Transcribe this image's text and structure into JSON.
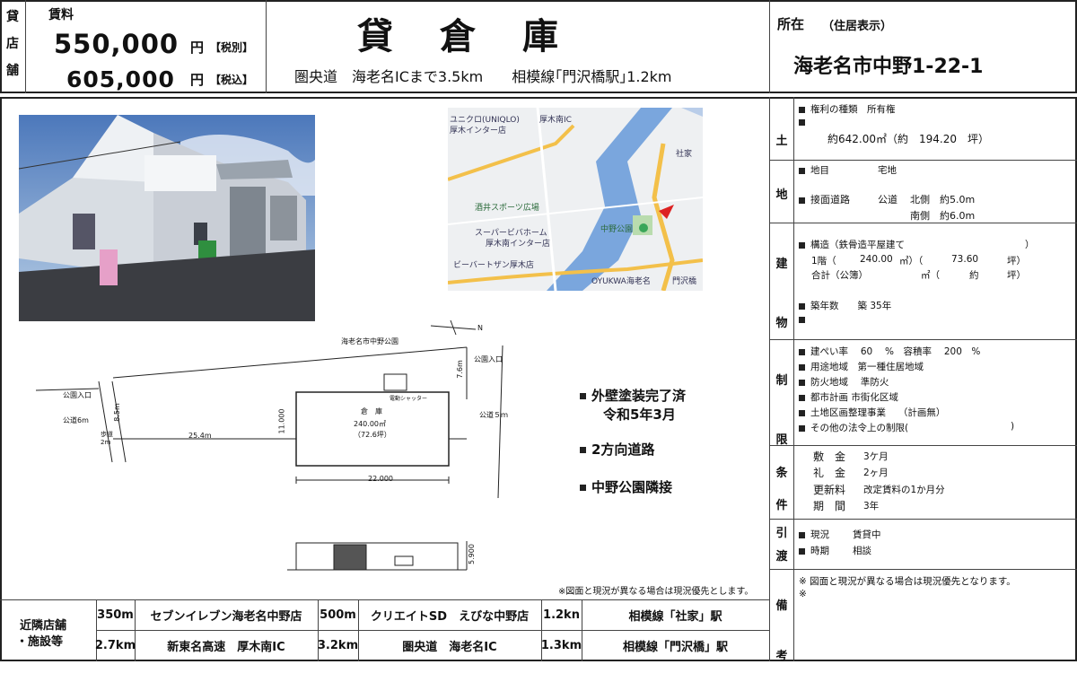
{
  "header": {
    "side_label": [
      "貸",
      "店",
      "舗"
    ],
    "rent_label": "賃料",
    "rent_ex_tax": "550,000",
    "rent_in_tax": "605,000",
    "yen": "円",
    "ex_tax_tag": "【税別】",
    "in_tax_tag": "【税込】",
    "title": "貸　倉　庫",
    "access": "圏央道　海老名ICまで3.5km　　相模線｢門沢橋駅｣1.2km",
    "location_label": "所在",
    "location_note": "（住居表示）",
    "address": "海老名市中野1-22-1"
  },
  "map": {
    "labels": [
      "ユニクロ(UNIQLO)",
      "厚木インター店",
      "酒井スポーツ広場",
      "スーパービバホーム",
      "厚木南インター店",
      "ビーバートザン厚木店",
      "中野公園",
      "社家",
      "厚木南IC",
      "OYUKWA海老名",
      "門沢橋"
    ]
  },
  "site_plan": {
    "park_label": "海老名市中野公園",
    "park_entrance_left": "公園入口",
    "park_entrance_right": "公園入口",
    "road_left": "公道6m",
    "road_right": "公道５ｍ",
    "sidewalk": "歩道",
    "sidewalk_w": "2m",
    "dim_85": "8.5m",
    "dim_254": "25.4m",
    "dim_76": "7.6m",
    "dim_11": "11.000",
    "dim_22": "22.000",
    "warehouse_label": "倉　庫",
    "warehouse_area": "240.00㎡",
    "warehouse_tsubo": "（72.6坪）",
    "shutter": "電動シャッター",
    "elev_height": "5.900",
    "north": "N"
  },
  "features": [
    "外壁塗装完了済",
    "令和5年3月",
    "2方向道路",
    "中野公園隣接"
  ],
  "note": "※図面と現況が異なる場合は現況優先とします。",
  "nearby": {
    "label_line1": "近隣店舗",
    "label_line2": "・施設等",
    "rows": [
      [
        "350m",
        "セブンイレブン海老名中野店",
        "500m",
        "クリエイトSD　えびな中野店",
        "1.2kn",
        "相模線「社家」駅"
      ],
      [
        "2.7km",
        "新東名高速　厚木南IC",
        "3.2km",
        "圏央道　海老名IC",
        "1.3km",
        "相模線「門沢橋」駅"
      ]
    ]
  },
  "right": {
    "land_label": [
      "土",
      "地"
    ],
    "land_rights_label": "権利の種類",
    "land_rights_value": "所有権",
    "land_area": "約642.00㎡（約　194.20　坪）",
    "land_chimoku_label": "地目",
    "land_chimoku_value": "宅地",
    "land_road_label": "接面道路",
    "land_road_type": "公道",
    "land_road_north": "北側　約5.0m",
    "land_road_south": "南側　約6.0m",
    "bldg_label": [
      "建",
      "物"
    ],
    "bldg_structure_label": "構造（",
    "bldg_structure_value": "鉄骨造平屋建て",
    "bldg_close_paren": "）",
    "bldg_1f_label": "1階（",
    "bldg_1f_m2": "240.00",
    "bldg_1f_mid": "㎡）（",
    "bldg_1f_tsubo": "73.60",
    "bldg_tsubo_unit": "坪）",
    "bldg_total_label": "合計（公簿）",
    "bldg_total_unit": "㎡（",
    "bldg_total_approx": "約",
    "bldg_age_label": "築年数",
    "bldg_age_value": "築 35年",
    "limit_label": [
      "制",
      "限"
    ],
    "limits": [
      "建ぺい率　 60　 %　容積率　 200　%",
      "用途地域　第一種住居地域",
      "防火地域　 準防火",
      "都市計画 市街化区域",
      "土地区画整理事業　 （計画無）",
      "その他の法令上の制限("
    ],
    "limit_close": ")",
    "cond_label": [
      "条",
      "件"
    ],
    "conditions": [
      [
        "敷　金",
        "3ケ月"
      ],
      [
        "礼　金",
        "2ヶ月"
      ],
      [
        "更新料",
        "改定賃料の1か月分"
      ],
      [
        "期　間",
        "3年"
      ]
    ],
    "transfer_label": [
      "引",
      "渡"
    ],
    "transfer_status_label": "現況",
    "transfer_status_value": "賃貸中",
    "transfer_time_label": "時期",
    "transfer_time_value": "相談",
    "remarks_label": [
      "備",
      "考"
    ],
    "remarks": [
      "図面と現況が異なる場合は現況優先となります。",
      ""
    ]
  }
}
